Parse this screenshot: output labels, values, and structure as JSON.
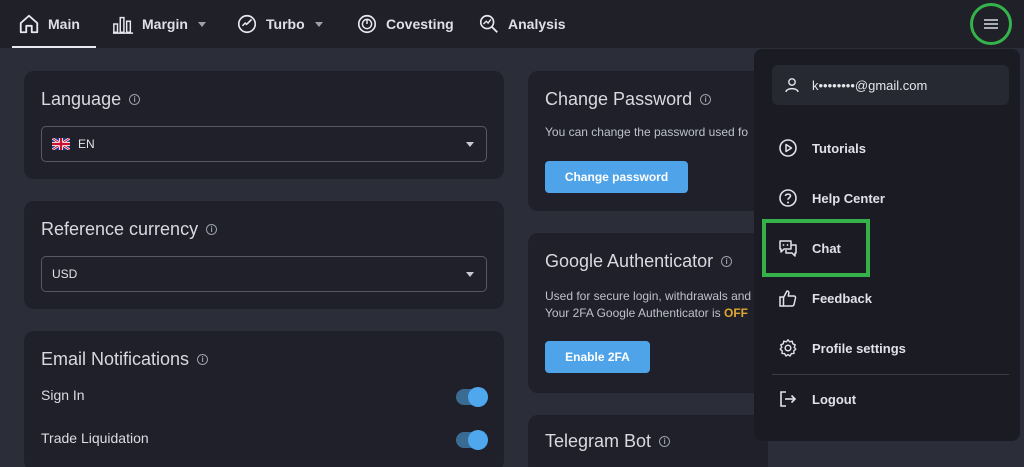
{
  "nav": {
    "items": [
      {
        "label": "Main",
        "active": true,
        "icon": "home-icon"
      },
      {
        "label": "Margin",
        "has_caret": true,
        "icon": "bar-chart-icon"
      },
      {
        "label": "Turbo",
        "has_caret": true,
        "icon": "turbo-icon"
      },
      {
        "label": "Covesting",
        "icon": "covesting-icon"
      },
      {
        "label": "Analysis",
        "icon": "analysis-icon"
      }
    ],
    "menu_icon": "hamburger-icon",
    "highlight_color": "#35b34a"
  },
  "language": {
    "title": "Language",
    "value": "EN",
    "flag": "uk-flag-icon"
  },
  "reference_currency": {
    "title": "Reference currency",
    "value": "USD"
  },
  "email_notifications": {
    "title": "Email Notifications",
    "rows": [
      {
        "label": "Sign In",
        "enabled": true
      },
      {
        "label": "Trade Liquidation",
        "enabled": true
      }
    ]
  },
  "change_password": {
    "title": "Change Password",
    "description": "You can change the password used fo",
    "button": "Change password"
  },
  "google_auth": {
    "title": "Google Authenticator",
    "line1": "Used for secure login, withdrawals and",
    "line2_prefix": "Your 2FA Google Authenticator is ",
    "status": "OFF",
    "button": "Enable 2FA"
  },
  "telegram": {
    "title": "Telegram Bot"
  },
  "menu": {
    "email": "k••••••••@gmail.com",
    "items": [
      {
        "label": "Tutorials",
        "icon": "play-circle-icon"
      },
      {
        "label": "Help Center",
        "icon": "question-circle-icon"
      },
      {
        "label": "Chat",
        "icon": "chat-icon"
      },
      {
        "label": "Feedback",
        "icon": "thumbs-up-icon"
      },
      {
        "label": "Profile settings",
        "icon": "gear-icon"
      },
      {
        "label": "Logout",
        "icon": "logout-icon"
      }
    ]
  },
  "colors": {
    "accent": "#4fa3e8",
    "highlight": "#35b34a",
    "off": "#e0a830"
  }
}
